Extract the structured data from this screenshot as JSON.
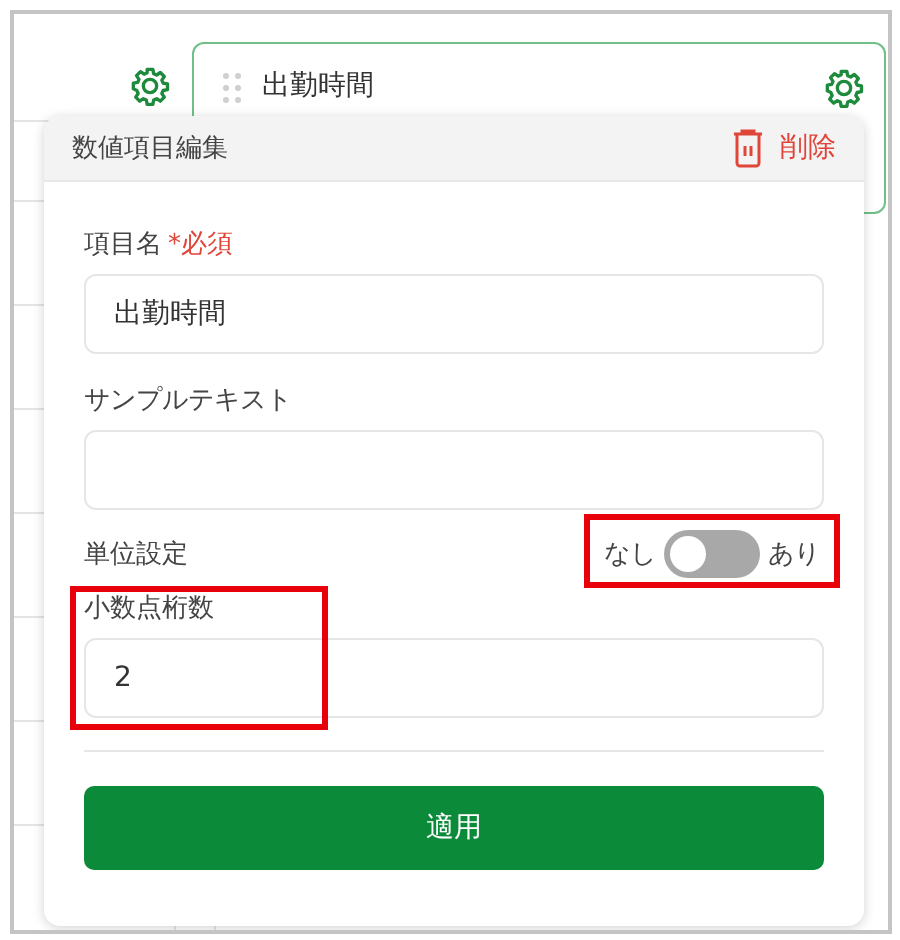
{
  "background_card": {
    "title": "出勤時間"
  },
  "popup": {
    "title": "数値項目編集",
    "delete_label": "削除",
    "fields": [
      {
        "kind": "text",
        "label": "項目名",
        "required_mark": "*必須",
        "value": "出勤時間"
      },
      {
        "kind": "text",
        "label": "サンプルテキスト"
      },
      {
        "kind": "toggle",
        "label": "単位設定",
        "off_label": "なし",
        "on_label": "あり",
        "on": false
      },
      {
        "kind": "text",
        "label": "小数点桁数",
        "value": "2"
      }
    ],
    "apply_button": "適用"
  }
}
